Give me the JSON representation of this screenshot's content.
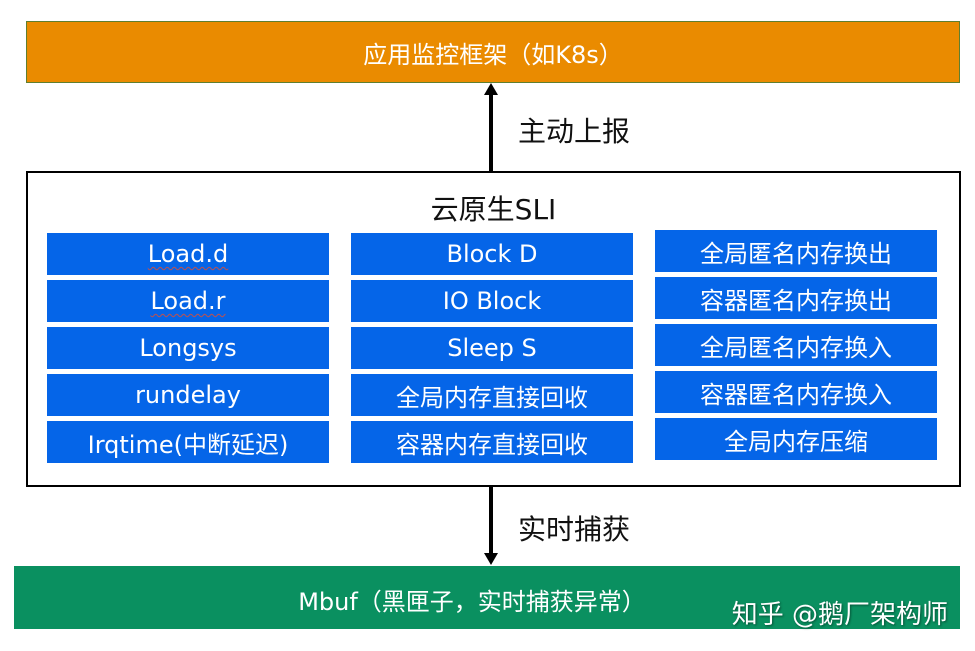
{
  "top_bar": {
    "label": "应用监控框架（如K8s）",
    "color": "#EA8B00"
  },
  "arrow_up": {
    "label": "主动上报"
  },
  "sli_box": {
    "title": "云原生SLI",
    "cell_color": "#0565E8",
    "columns": [
      {
        "items": [
          "Load.d",
          "Load.r",
          "Longsys",
          "rundelay",
          "Irqtime(中断延迟)"
        ]
      },
      {
        "items": [
          "Block D",
          "IO Block",
          "Sleep S",
          "全局内存直接回收",
          "容器内存直接回收"
        ]
      },
      {
        "items": [
          "全局匿名内存换出",
          "容器匿名内存换出",
          "全局匿名内存换入",
          "容器匿名内存换入",
          "全局内存压缩"
        ]
      }
    ]
  },
  "arrow_down": {
    "label": "实时捕获"
  },
  "bottom_bar": {
    "label": "Mbuf（黑匣子，实时捕获异常）",
    "color": "#0A9060"
  },
  "watermark": {
    "text": "知乎 @鹅厂架构师"
  }
}
